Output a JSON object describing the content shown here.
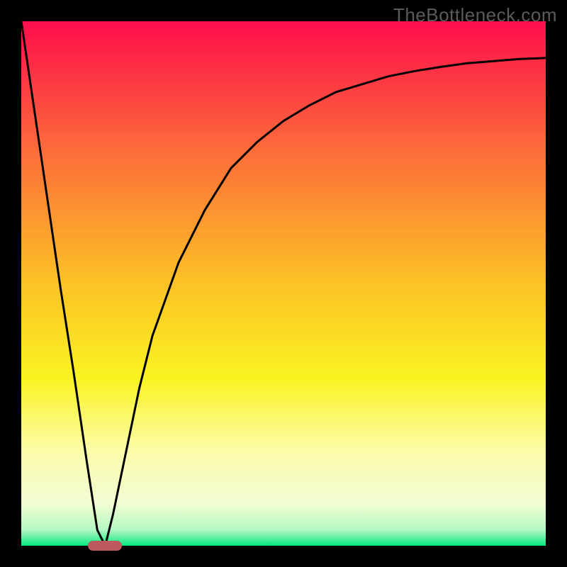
{
  "watermark": "TheBottleneck.com",
  "colors": {
    "frame": "#000000",
    "curve": "#000000",
    "marker": "#be5a5f",
    "gradient_stops": [
      {
        "pos": 0.0,
        "color": "#fe0e4c"
      },
      {
        "pos": 0.25,
        "color": "#fc6d3a"
      },
      {
        "pos": 0.5,
        "color": "#fcc226"
      },
      {
        "pos": 0.68,
        "color": "#faf321"
      },
      {
        "pos": 0.82,
        "color": "#fcfcaa"
      },
      {
        "pos": 0.92,
        "color": "#f2fdd3"
      },
      {
        "pos": 0.97,
        "color": "#b4f8c3"
      },
      {
        "pos": 1.0,
        "color": "#03e87c"
      }
    ]
  },
  "chart_data": {
    "type": "line",
    "title": "",
    "xlabel": "",
    "ylabel": "",
    "xlim": [
      0,
      1
    ],
    "ylim": [
      0,
      1
    ],
    "note": "Axis values unlabeled in source; 0=left/bottom, 1=right/top. y is bottleneck magnitude (green≈0 good, red≈1 bad).",
    "series": [
      {
        "name": "curve",
        "x": [
          0.0,
          0.025,
          0.05,
          0.075,
          0.1,
          0.125,
          0.145,
          0.16,
          0.175,
          0.2,
          0.225,
          0.25,
          0.3,
          0.35,
          0.4,
          0.45,
          0.5,
          0.55,
          0.6,
          0.65,
          0.7,
          0.75,
          0.8,
          0.85,
          0.9,
          0.95,
          1.0
        ],
        "values": [
          1.0,
          0.83,
          0.66,
          0.49,
          0.33,
          0.16,
          0.03,
          0.0,
          0.06,
          0.18,
          0.3,
          0.4,
          0.54,
          0.64,
          0.72,
          0.77,
          0.81,
          0.84,
          0.865,
          0.88,
          0.895,
          0.905,
          0.913,
          0.92,
          0.924,
          0.928,
          0.93
        ]
      }
    ],
    "annotations": [
      {
        "name": "minimum-marker",
        "x": 0.16,
        "y": 0.0,
        "shape": "rounded-pill",
        "color": "#be5a5f"
      }
    ]
  }
}
